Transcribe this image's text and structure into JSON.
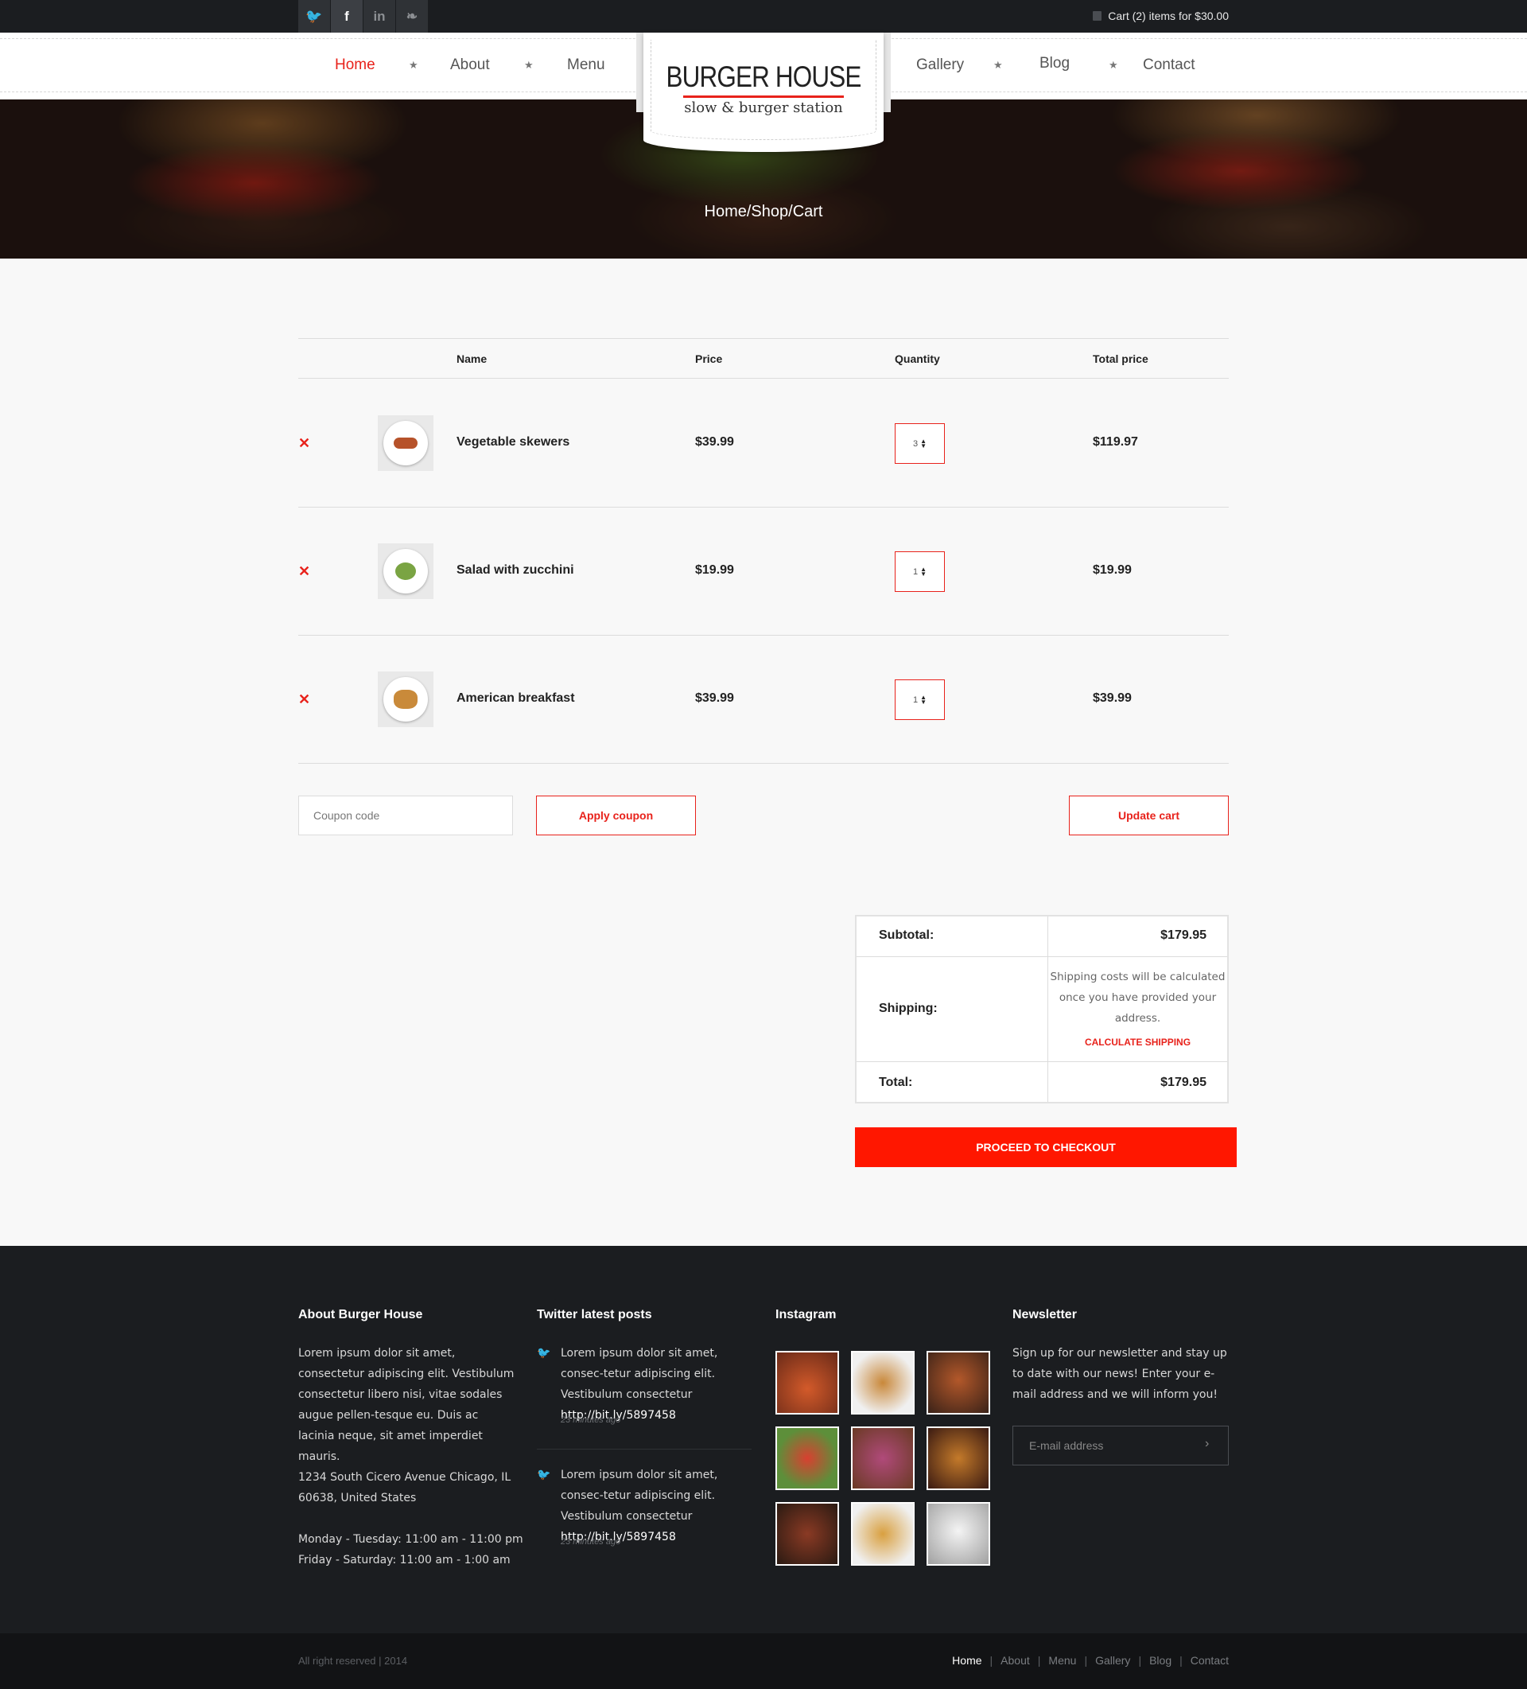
{
  "topbar": {
    "social": [
      {
        "icon": "twitter-icon",
        "glyph": "🐦"
      },
      {
        "icon": "facebook-icon",
        "glyph": "f"
      },
      {
        "icon": "linkedin-icon",
        "glyph": "in"
      },
      {
        "icon": "evernote-icon",
        "glyph": "❧"
      }
    ],
    "cart_text": "Cart (2) items for $30.00"
  },
  "nav": {
    "items": [
      "Home",
      "About",
      "Menu",
      "Gallery",
      "Blog",
      "Contact"
    ],
    "active": "Home"
  },
  "logo": {
    "name": "BURGER HOUSE",
    "tagline": "slow & burger station"
  },
  "hero": {
    "breadcrumb": "Home/Shop/Cart"
  },
  "cart": {
    "headers": {
      "name": "Name",
      "price": "Price",
      "quantity": "Quantity",
      "total": "Total price"
    },
    "items": [
      {
        "name": "Vegetable skewers",
        "price": "$39.99",
        "qty": "3",
        "total": "$119.97",
        "food_color": "#b6522a"
      },
      {
        "name": "Salad with zucchini",
        "price": "$19.99",
        "qty": "1",
        "total": "$19.99",
        "food_color": "#7aa443"
      },
      {
        "name": "American breakfast",
        "price": "$39.99",
        "qty": "1",
        "total": "$39.99",
        "food_color": "#c98a3a"
      }
    ],
    "remove_glyph": "✕",
    "coupon_placeholder": "Coupon code",
    "apply_label": "Apply coupon",
    "update_label": "Update cart"
  },
  "totals": {
    "subtotal_label": "Subtotal:",
    "subtotal_value": "$179.95",
    "shipping_label": "Shipping:",
    "shipping_text": "Shipping costs will be calculated once you have provided your address.",
    "calculate_label": "CALCULATE SHIPPING",
    "total_label": "Total:",
    "total_value": "$179.95",
    "checkout_label": "PROCEED TO CHECKOUT"
  },
  "footer": {
    "about": {
      "title": "About Burger House",
      "text": "Lorem ipsum dolor sit amet, consectetur adipiscing elit. Vestibulum consectetur libero nisi, vitae sodales augue pellen-tesque eu. Duis ac lacinia neque, sit amet imperdiet mauris.",
      "address": "1234 South Cicero Avenue Chicago, IL 60638, United States",
      "hours_1": "Monday - Tuesday: 11:00 am - 11:00 pm",
      "hours_2": "Friday - Saturday: 11:00 am - 1:00 am"
    },
    "twitter": {
      "title": "Twitter latest posts",
      "posts": [
        {
          "text": "Lorem ipsum dolor sit amet, consec-tetur adipiscing elit. Vestibulum consectetur",
          "link": "http://bit.ly/5897458",
          "ago": "23 minutes ago"
        },
        {
          "text": "Lorem ipsum dolor sit amet, consec-tetur adipiscing elit. Vestibulum consectetur",
          "link": "http://bit.ly/5897458",
          "ago": "23 minutes ago"
        }
      ]
    },
    "instagram": {
      "title": "Instagram",
      "photos": [
        "#a8401f",
        "#8a6a3a",
        "#b3582a",
        "#5d8f3a",
        "#7b3f6a",
        "#a8582a",
        "#6a3a24",
        "#c08a3a",
        "#dcdcdc"
      ]
    },
    "newsletter": {
      "title": "Newsletter",
      "text": "Sign up for our newsletter and stay up to date with our news! Enter your e-mail address and we will inform you!",
      "placeholder": "E-mail address",
      "submit_glyph": "›"
    }
  },
  "bottombar": {
    "copyright": "All right reserved | 2014",
    "links": [
      "Home",
      "About",
      "Menu",
      "Gallery",
      "Blog",
      "Contact"
    ]
  }
}
